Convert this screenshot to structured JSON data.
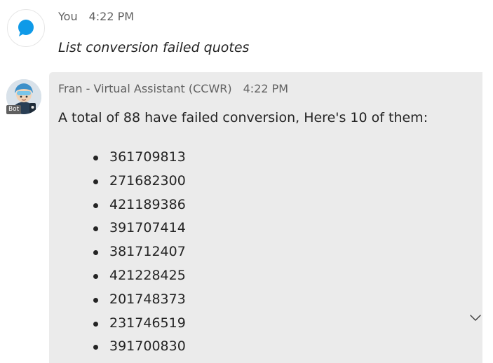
{
  "user_message": {
    "sender": "You",
    "time": "4:22 PM",
    "text": "List conversion failed quotes",
    "avatar_icon": "chat-bubble-icon",
    "avatar_color": "#0f9ae8"
  },
  "bot_message": {
    "sender": "Fran - Virtual Assistant (CCWR)",
    "time": "4:22 PM",
    "badge": "Bot",
    "text": "A total of 88 have failed conversion, Here's 10 of them:",
    "quotes": [
      "361709813",
      "271682300",
      "421189386",
      "391707414",
      "381712407",
      "421228425",
      "201748373",
      "231746519",
      "391700830"
    ],
    "bubble_color": "#ebebeb"
  },
  "scroll_button": {
    "icon": "chevron-down-icon"
  }
}
